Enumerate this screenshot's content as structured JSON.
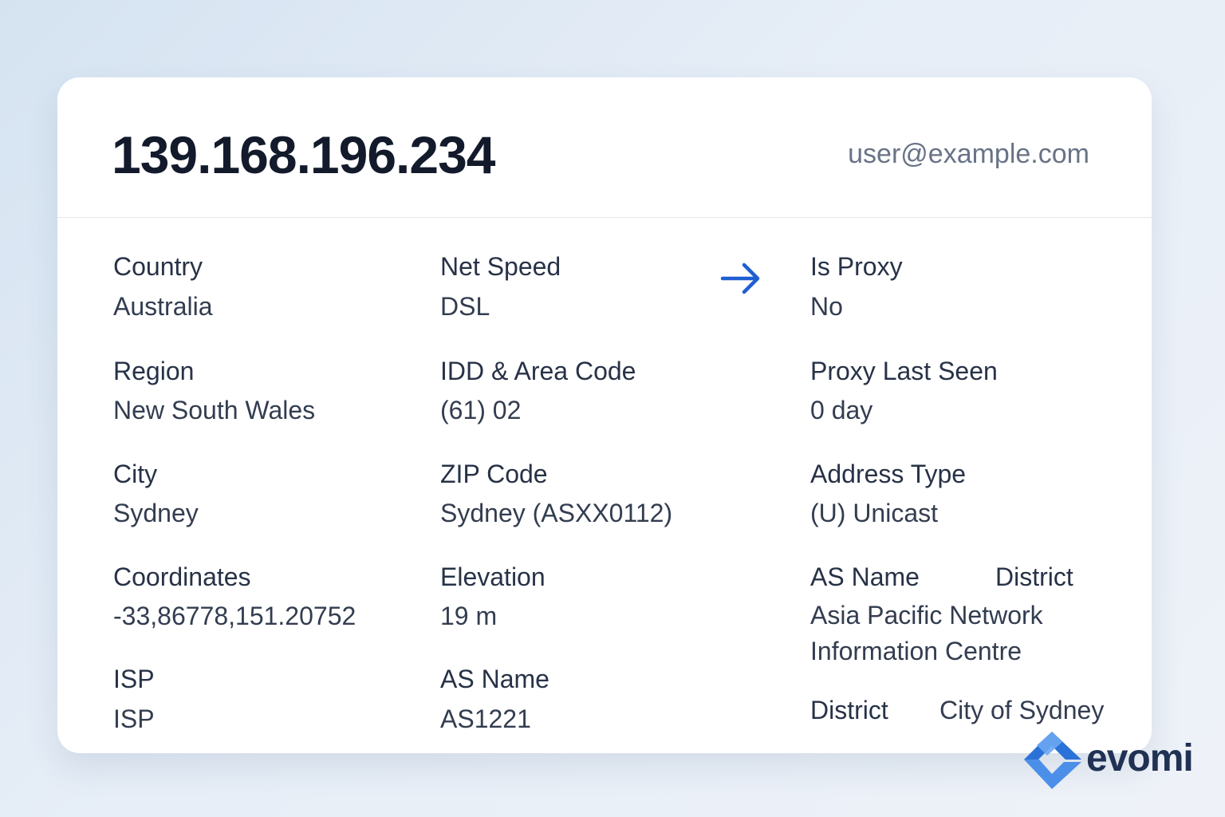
{
  "header": {
    "ip": "139.168.196.234",
    "email": "user@example.com"
  },
  "fields": {
    "country": {
      "label": "Country",
      "value": "Australia"
    },
    "region": {
      "label": "Region",
      "value": "New South Wales"
    },
    "city": {
      "label": "City",
      "value": "Sydney"
    },
    "coordinates": {
      "label": "Coordinates",
      "value": "-33,86778,151.20752"
    },
    "isp": {
      "label": "ISP",
      "value": "ISP"
    },
    "net_speed": {
      "label": "Net Speed",
      "value": "DSL"
    },
    "idd_area_code": {
      "label": "IDD & Area Code",
      "value": "(61) 02"
    },
    "zip_code": {
      "label": "ZIP Code",
      "value": "Sydney (ASXX0112)"
    },
    "elevation": {
      "label": "Elevation",
      "value": "19 m"
    },
    "as_name_middle": {
      "label": "AS Name",
      "value": "AS1221"
    },
    "is_proxy": {
      "label": "Is Proxy",
      "value": "No"
    },
    "proxy_last_seen": {
      "label": "Proxy Last Seen",
      "value": "0 day"
    },
    "address_type": {
      "label": "Address Type",
      "value": "(U) Unicast"
    },
    "as_name_right": {
      "label": "AS Name",
      "value": "Asia Pacific Network Information Centre"
    },
    "district_heading": {
      "label": "District"
    },
    "district": {
      "label": "District",
      "value": "City of Sydney"
    }
  },
  "icons": {
    "forward": "arrow-right-icon",
    "brand": "evomi-logo-mark"
  },
  "brand": {
    "name": "evomi"
  },
  "colors": {
    "accent": "#1f5fd1",
    "background": "#dde8f4",
    "card": "#ffffff",
    "text": "#1d2433"
  }
}
